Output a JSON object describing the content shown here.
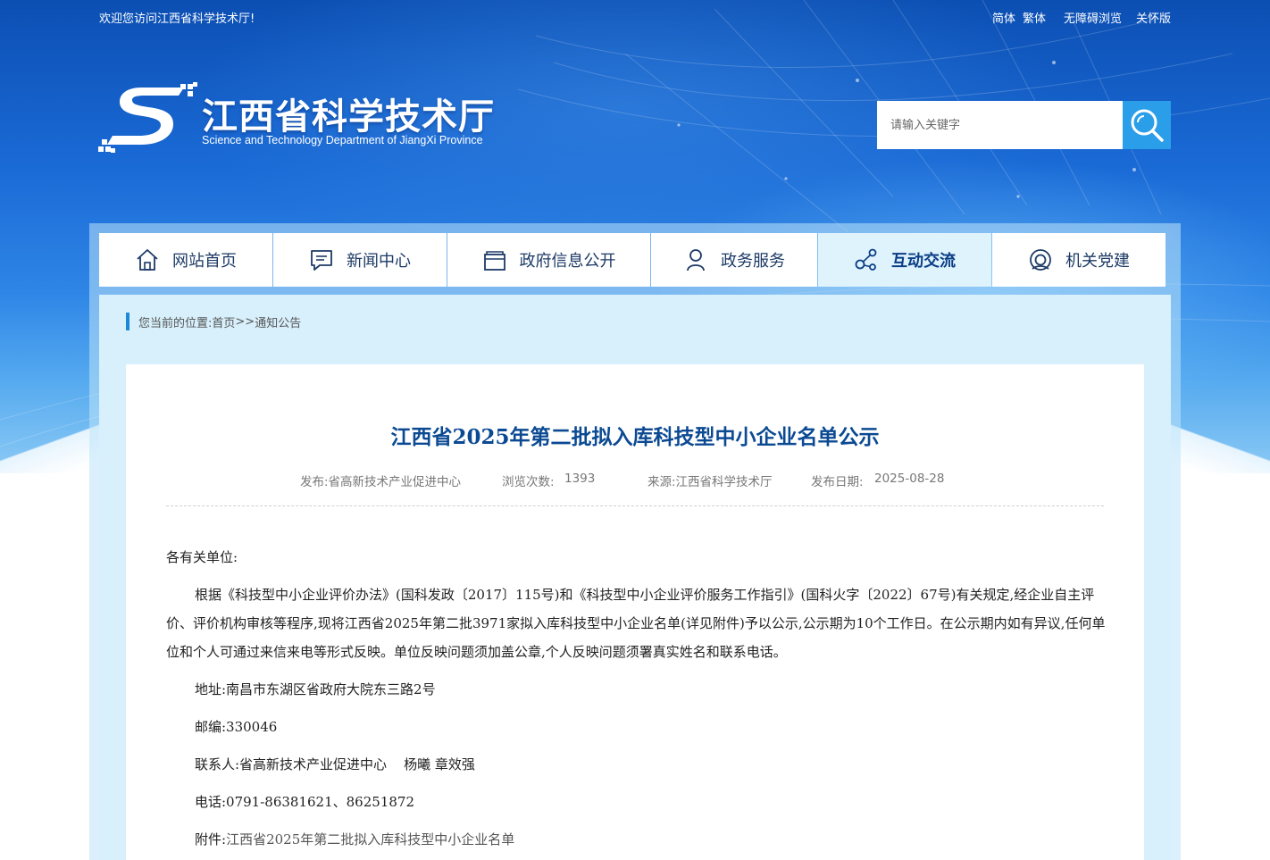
{
  "topbar": {
    "welcome": "欢迎您访问江西省科学技术厅!",
    "simplified": "简体",
    "traditional": "繁体",
    "accessible": "无障碍浏览",
    "elderly": "关怀版"
  },
  "logo": {
    "cn": "江西省科学技术厅",
    "en": "Science and Technology Department of JiangXi Province"
  },
  "search": {
    "placeholder": "请输入关键字"
  },
  "nav": {
    "items": [
      {
        "label": "网站首页",
        "icon": "home-icon"
      },
      {
        "label": "新闻中心",
        "icon": "news-icon"
      },
      {
        "label": "政府信息公开",
        "icon": "folder-icon"
      },
      {
        "label": "政务服务",
        "icon": "user-icon"
      },
      {
        "label": "互动交流",
        "icon": "share-icon",
        "active": true
      },
      {
        "label": "机关党建",
        "icon": "party-icon"
      }
    ]
  },
  "breadcrumb": {
    "prefix": "您当前的位置:",
    "home": "首页",
    "sep": ">>",
    "current": "通知公告"
  },
  "article": {
    "title": "江西省2025年第二批拟入库科技型中小企业名单公示",
    "meta": {
      "publisher": "发布:省高新技术产业促进中心",
      "views_label": "浏览次数:",
      "views": "1393",
      "source": "来源:江西省科学技术厅",
      "date_label": "发布日期:",
      "date": "2025-08-28"
    },
    "salutation": "各有关单位:",
    "paragraph": "根据《科技型中小企业评价办法》(国科发政〔2017〕115号)和《科技型中小企业评价服务工作指引》(国科火字〔2022〕67号)有关规定,经企业自主评价、评价机构审核等程序,现将江西省2025年第二批3971家拟入库科技型中小企业名单(详见附件)予以公示,公示期为10个工作日。在公示期内如有异议,任何单位和个人可通过来信来电等形式反映。单位反映问题须加盖公章,个人反映问题须署真实姓名和联系电话。",
    "address": "地址:南昌市东湖区省政府大院东三路2号",
    "postcode": "邮编:330046",
    "contact": "联系人:省高新技术产业促进中心    杨曦 章效强",
    "phone": "电话:0791-86381621、86251872",
    "attachment_label": "附件:",
    "attachment": "江西省2025年第二批拟入库科技型中小企业名单"
  },
  "colors": {
    "accent": "#1e88d8",
    "title": "#0b4a93",
    "search_button": "#2a9ee8"
  }
}
